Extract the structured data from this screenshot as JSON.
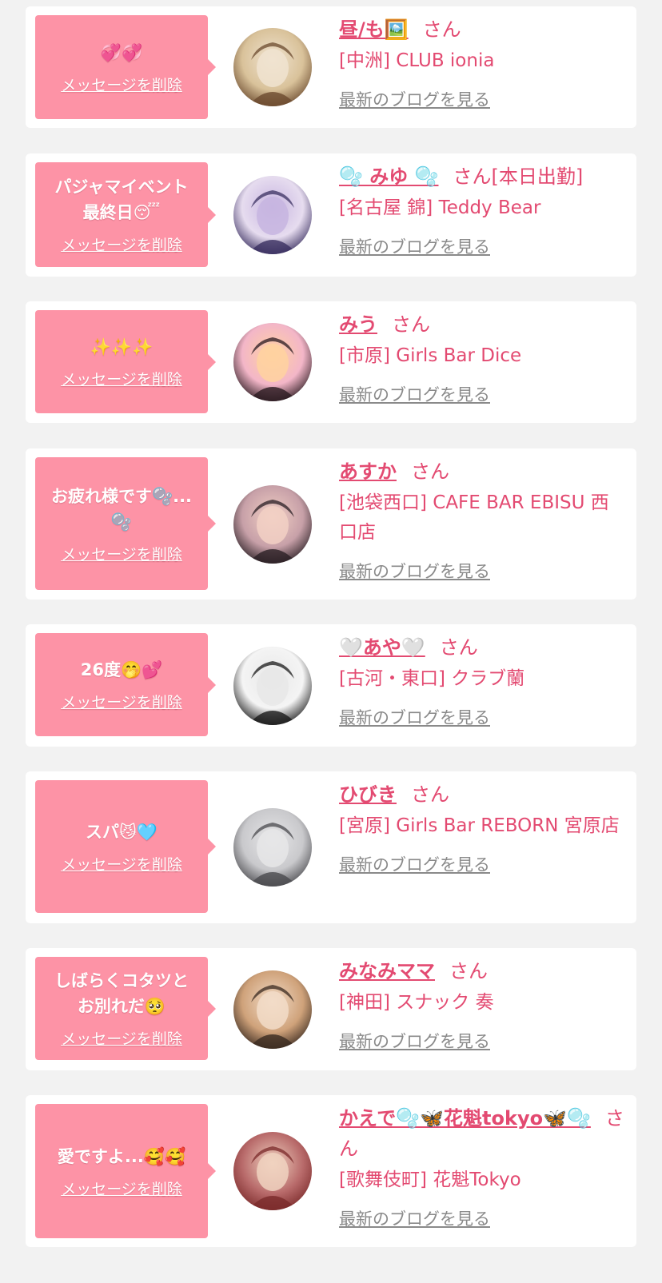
{
  "messages": [
    {
      "message": "💞💞",
      "delete_label": "メッセージを削除",
      "name": "昼/も🖼️",
      "honorific": "さん",
      "extra": "",
      "shop": "[中洲] CLUB ionia",
      "blog_label": "最新のブログを見る",
      "avatar_icon": "profile-photo"
    },
    {
      "message": "パジャマイベント\n最終日😴",
      "delete_label": "メッセージを削除",
      "name": "🫧 みゆ 🫧",
      "honorific": "さん",
      "extra": "[本日出勤]",
      "shop": "[名古屋 錦] Teddy Bear",
      "blog_label": "最新のブログを見る",
      "avatar_icon": "profile-photo"
    },
    {
      "message": "✨✨✨",
      "delete_label": "メッセージを削除",
      "name": "みう",
      "honorific": "さん",
      "extra": "",
      "shop": "[市原] Girls Bar Dice",
      "blog_label": "最新のブログを見る",
      "avatar_icon": "profile-photo"
    },
    {
      "message": "お疲れ様です🫧...\n🫧",
      "delete_label": "メッセージを削除",
      "name": "あすか",
      "honorific": "さん",
      "extra": "",
      "shop": "[池袋西口] CAFE BAR EBISU 西口店",
      "blog_label": "最新のブログを見る",
      "avatar_icon": "profile-photo"
    },
    {
      "message": "26度🤭💕",
      "delete_label": "メッセージを削除",
      "name": "🤍あや🤍",
      "honorific": "さん",
      "extra": "",
      "shop": "[古河・東口] クラブ蘭",
      "blog_label": "最新のブログを見る",
      "avatar_icon": "profile-photo"
    },
    {
      "message": "スパ😼🩵",
      "delete_label": "メッセージを削除",
      "name": "ひびき",
      "honorific": "さん",
      "extra": "",
      "shop": "[宮原] Girls Bar REBORN 宮原店",
      "blog_label": "最新のブログを見る",
      "avatar_icon": "profile-photo"
    },
    {
      "message": "しばらくコタツと\nお別れだ🥺",
      "delete_label": "メッセージを削除",
      "name": "みなみママ",
      "honorific": "さん",
      "extra": "",
      "shop": "[神田] スナック 奏",
      "blog_label": "最新のブログを見る",
      "avatar_icon": "profile-photo"
    },
    {
      "message": "愛ですよ...🥰🥰",
      "delete_label": "メッセージを削除",
      "name": "かえで🫧🦋花魁tokyo🦋🫧",
      "honorific": "さん",
      "extra": "",
      "shop": "[歌舞伎町] 花魁Tokyo",
      "blog_label": "最新のブログを見る",
      "avatar_icon": "profile-photo"
    }
  ],
  "colors": {
    "bubble": "#fd93a6",
    "name": "#e34a71",
    "blog_link": "#8a8a8a",
    "background": "#f2f2f2"
  }
}
